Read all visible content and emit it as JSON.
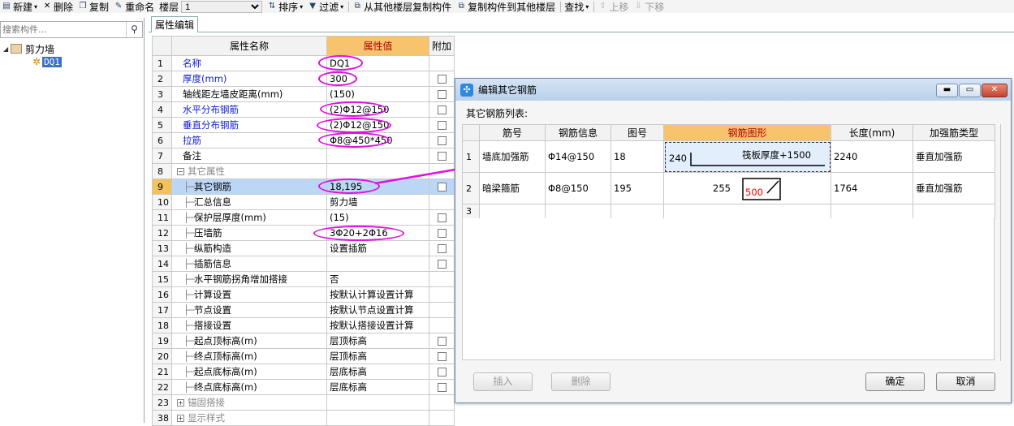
{
  "toolbar": {
    "new": "新建",
    "delete": "删除",
    "copy": "复制",
    "rename": "重命名",
    "floor_label": "楼层",
    "floor_value": "1",
    "sort": "排序",
    "filter": "过滤",
    "copy_from_floor": "从其他楼层复制构件",
    "copy_to_floor": "复制构件到其他楼层",
    "find": "查找",
    "move_up": "上移",
    "move_down": "下移"
  },
  "left": {
    "search_placeholder": "搜索构件...",
    "tree_root": "剪力墙",
    "tree_child": "DQ1"
  },
  "tab": "属性编辑",
  "grid": {
    "headers": [
      "属性名称",
      "属性值",
      "附加"
    ],
    "rows": [
      {
        "n": "1",
        "name": "名称",
        "value": "DQ1"
      },
      {
        "n": "2",
        "name": "厚度(mm)",
        "value": "300"
      },
      {
        "n": "3",
        "name": "轴线距左墙皮距离(mm)",
        "value": "(150)"
      },
      {
        "n": "4",
        "name": "水平分布钢筋",
        "value": "(2)Φ12@150"
      },
      {
        "n": "5",
        "name": "垂直分布钢筋",
        "value": "(2)Φ12@150"
      },
      {
        "n": "6",
        "name": "拉筋",
        "value": "Φ8@450*450"
      },
      {
        "n": "7",
        "name": "备注",
        "value": ""
      },
      {
        "n": "8",
        "name": "其它属性",
        "value": ""
      },
      {
        "n": "9",
        "name": "其它钢筋",
        "value": "18,195"
      },
      {
        "n": "10",
        "name": "汇总信息",
        "value": "剪力墙"
      },
      {
        "n": "11",
        "name": "保护层厚度(mm)",
        "value": "(15)"
      },
      {
        "n": "12",
        "name": "压墙筋",
        "value": "3Φ20+2Φ16"
      },
      {
        "n": "13",
        "name": "纵筋构造",
        "value": "设置插筋"
      },
      {
        "n": "14",
        "name": "插筋信息",
        "value": ""
      },
      {
        "n": "15",
        "name": "水平钢筋拐角增加搭接",
        "value": "否"
      },
      {
        "n": "16",
        "name": "计算设置",
        "value": "按默认计算设置计算"
      },
      {
        "n": "17",
        "name": "节点设置",
        "value": "按默认节点设置计算"
      },
      {
        "n": "18",
        "name": "搭接设置",
        "value": "按默认搭接设置计算"
      },
      {
        "n": "19",
        "name": "起点顶标高(m)",
        "value": "层顶标高"
      },
      {
        "n": "20",
        "name": "终点顶标高(m)",
        "value": "层顶标高"
      },
      {
        "n": "21",
        "name": "起点底标高(m)",
        "value": "层底标高"
      },
      {
        "n": "22",
        "name": "终点底标高(m)",
        "value": "层底标高"
      },
      {
        "n": "23",
        "name": "锚固搭接",
        "value": ""
      },
      {
        "n": "38",
        "name": "显示样式",
        "value": ""
      }
    ]
  },
  "dialog": {
    "title": "编辑其它钢筋",
    "list_label": "其它钢筋列表:",
    "headers": [
      "筋号",
      "钢筋信息",
      "图号",
      "钢筋图形",
      "长度(mm)",
      "加强筋类型"
    ],
    "rows": [
      {
        "n": "1",
        "name": "墙底加强筋",
        "info": "Φ14@150",
        "fig": "18",
        "shape_left": "240",
        "shape_label": "筏板厚度+1500",
        "length": "2240",
        "type": "垂直加强筋"
      },
      {
        "n": "2",
        "name": "暗梁箍筋",
        "info": "Φ8@150",
        "fig": "195",
        "shape_left": "255",
        "shape_label": "500",
        "length": "1764",
        "type": "垂直加强筋"
      },
      {
        "n": "3",
        "name": "",
        "info": "",
        "fig": "",
        "shape_left": "",
        "shape_label": "",
        "length": "",
        "type": ""
      }
    ],
    "insert": "插入",
    "delete": "删除",
    "ok": "确定",
    "cancel": "取消"
  },
  "colors": {
    "highlight_circle": "#e010e0",
    "header_value": "#f7c46d",
    "active_row": "#bcd7f5"
  }
}
